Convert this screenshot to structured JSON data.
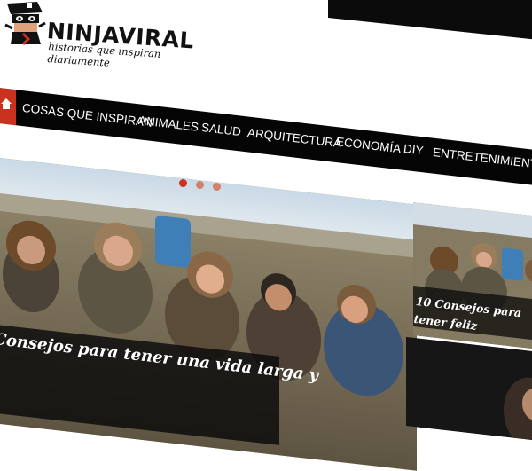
{
  "site": {
    "name": "NINJAVIRAL",
    "tagline": "historias que inspiran diariamente"
  },
  "nav": {
    "home_icon": "home-icon",
    "items": [
      {
        "label": "COSAS QUE INSPIRAN"
      },
      {
        "label": "ANIMALES"
      },
      {
        "label": "SALUD"
      },
      {
        "label": "ARQUITECTURA"
      },
      {
        "label": "ECONOMÍA"
      },
      {
        "label": "DIY"
      },
      {
        "label": "ENTRETENIMIENTO"
      }
    ]
  },
  "slider": {
    "dots": [
      "active",
      "inactive",
      "inactive"
    ],
    "main_caption": "Consejos para tener una vida larga y",
    "side_caption": "10 Consejos para tener feliz"
  },
  "colors": {
    "accent": "#c9321f",
    "nav_bg": "#050505",
    "dot_active": "#c9321f",
    "dot_inactive": "#d3806a"
  }
}
